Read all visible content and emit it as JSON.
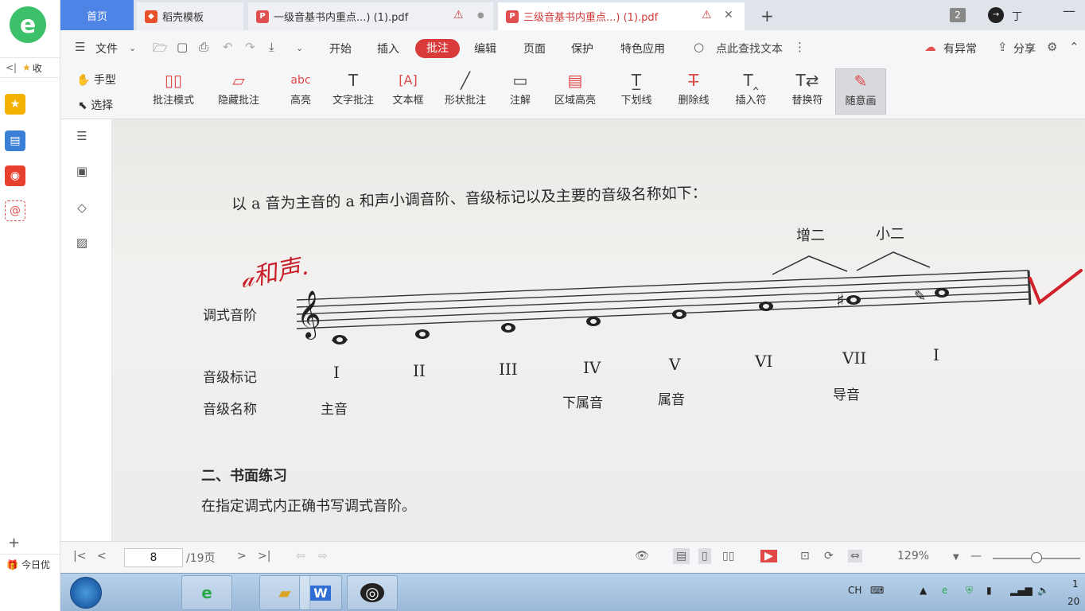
{
  "browser": {
    "favorites_label": "收",
    "today_label": "今日优"
  },
  "tabs": [
    {
      "label": "首页"
    },
    {
      "label": "稻壳模板"
    },
    {
      "label": "一级音基书内重点...) (1).pdf"
    },
    {
      "label": "三级音基书内重点...) (1).pdf"
    }
  ],
  "window": {
    "tab_count": "2",
    "user": "丁"
  },
  "menubar": {
    "file": "文件",
    "items": [
      "开始",
      "插入",
      "批注",
      "编辑",
      "页面",
      "保护",
      "特色应用"
    ],
    "search": "点此查找文本",
    "anomaly": "有异常",
    "share": "分享"
  },
  "ribbon": {
    "hand": "手型",
    "select": "选择",
    "tools": [
      "批注模式",
      "隐藏批注",
      "高亮",
      "文字批注",
      "文本框",
      "形状批注",
      "注解",
      "区域高亮",
      "下划线",
      "删除线",
      "插入符",
      "替换符",
      "随意画"
    ]
  },
  "document": {
    "intro": "以 a 音为主音的 a 和声小调音阶、音级标记以及主要的音级名称如下：",
    "interval_1": "增二",
    "interval_2": "小二",
    "row_scale": "调式音阶",
    "row_degree_marks": "音级标记",
    "row_degree_names": "音级名称",
    "degrees": [
      "I",
      "II",
      "III",
      "IV",
      "V",
      "VI",
      "VII",
      "I"
    ],
    "names": {
      "tonic": "主音",
      "subdominant": "下属音",
      "dominant": "属音",
      "leading": "导音"
    },
    "section_title": "二、书面练习",
    "exercise": "在指定调式内正确书写调式音阶。",
    "handwriting": "a和声."
  },
  "statusbar": {
    "page": "8",
    "total": "/19页",
    "zoom": "129%"
  },
  "taskbar": {
    "ime": "CH",
    "clock_time": "1",
    "clock_date": "20"
  }
}
